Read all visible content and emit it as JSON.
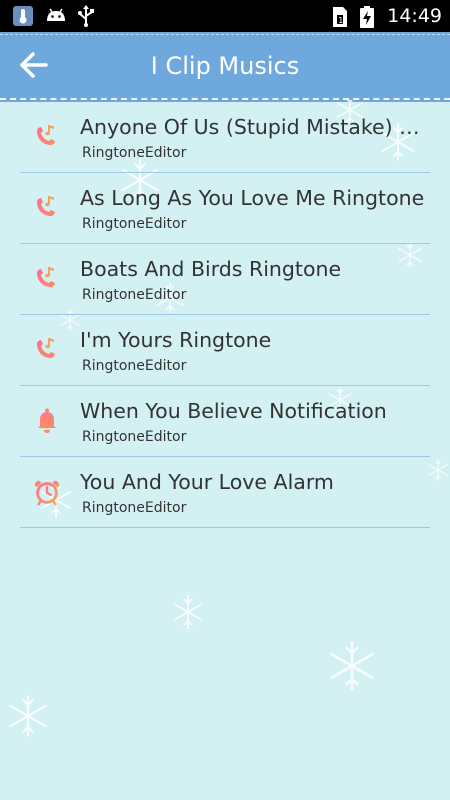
{
  "status_bar": {
    "left_icons": [
      "thermometer-icon",
      "android-icon",
      "usb-icon"
    ],
    "right_icons": [
      "sim-card-icon",
      "battery-charging-icon"
    ],
    "time": "14:49"
  },
  "app_bar": {
    "back_icon": "arrow-left-icon",
    "title": "I Clip Musics"
  },
  "colors": {
    "app_bar": "#6fa8dc",
    "background": "#d3f0f3",
    "divider": "#9fc7e6",
    "icon_gradient_start": "#ff6f8f",
    "icon_gradient_end": "#f7b267"
  },
  "items": [
    {
      "icon": "phone-music-icon",
      "name": "Anyone Of Us (Stupid Mistake) Ringtone",
      "subtitle": "RingtoneEditor"
    },
    {
      "icon": "phone-music-icon",
      "name": "As Long As You Love Me Ringtone",
      "subtitle": "RingtoneEditor"
    },
    {
      "icon": "phone-music-icon",
      "name": "Boats And Birds Ringtone",
      "subtitle": "RingtoneEditor"
    },
    {
      "icon": "phone-music-icon",
      "name": "I'm Yours Ringtone",
      "subtitle": "RingtoneEditor"
    },
    {
      "icon": "bell-icon",
      "name": "When You Believe Notification",
      "subtitle": "RingtoneEditor"
    },
    {
      "icon": "alarm-clock-icon",
      "name": "You And Your Love Alarm",
      "subtitle": "RingtoneEditor"
    }
  ]
}
